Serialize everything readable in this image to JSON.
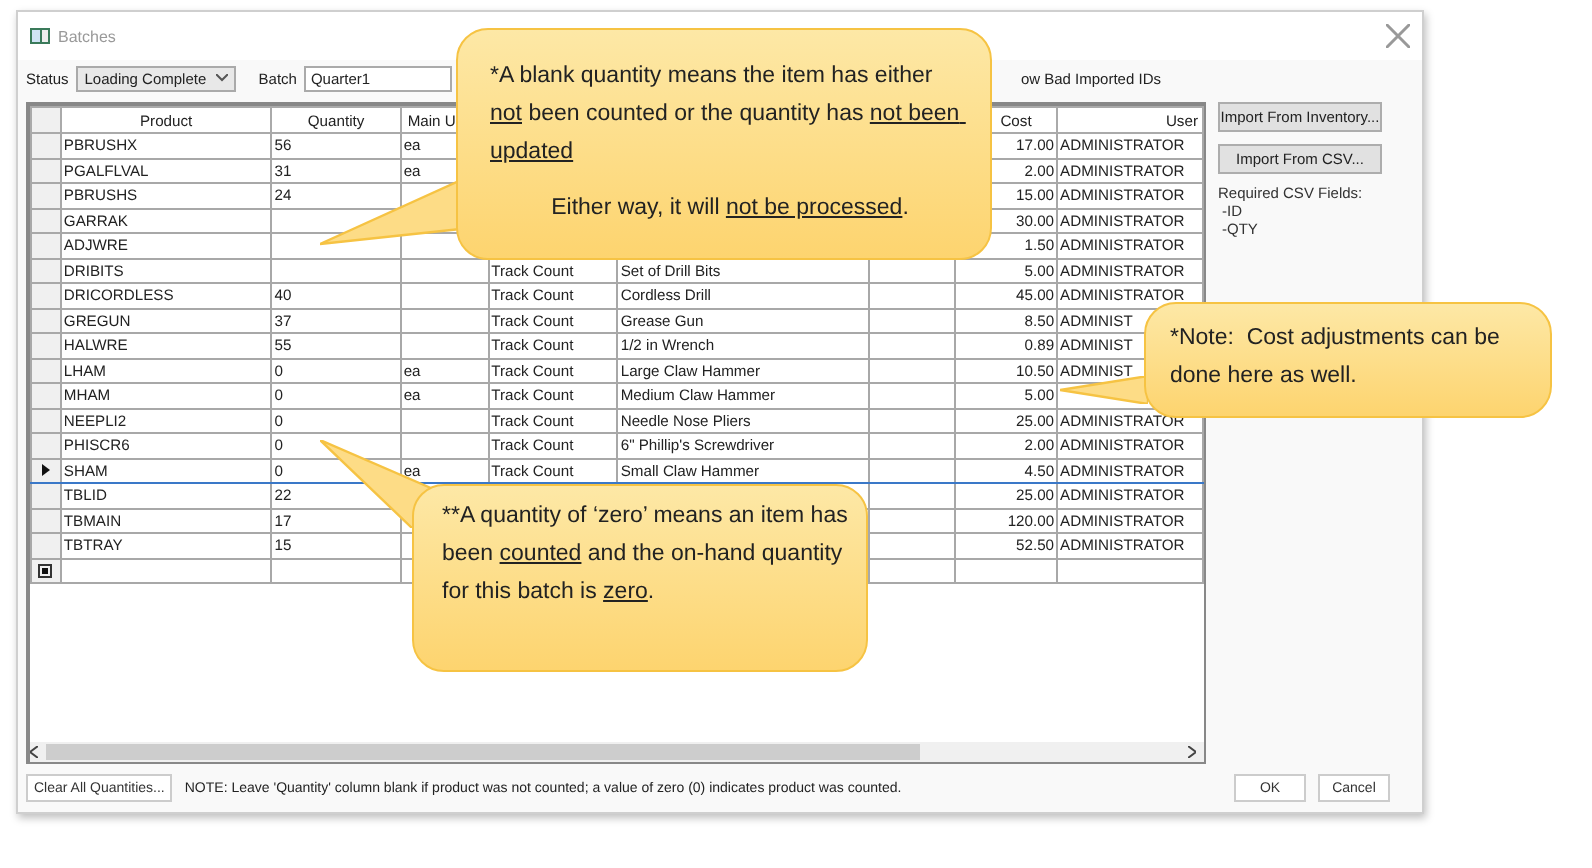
{
  "window": {
    "title": "Batches"
  },
  "toolbar": {
    "status_label": "Status",
    "status_value": "Loading Complete",
    "batch_label": "Batch",
    "batch_value": "Quarter1",
    "show_bad_ids_label": "ow Bad Imported IDs"
  },
  "table": {
    "columns": [
      "Product",
      "Quantity",
      "Main U",
      null,
      null,
      null,
      "Cost",
      "User"
    ],
    "rows": [
      {
        "cells": [
          "PBRUSHX",
          "56",
          "ea",
          null,
          null,
          null,
          "17.00",
          "ADMINISTRATOR"
        ],
        "selected": false
      },
      {
        "cells": [
          "PGALFLVAL",
          "31",
          "ea",
          null,
          null,
          null,
          "2.00",
          "ADMINISTRATOR"
        ],
        "selected": false
      },
      {
        "cells": [
          "PBRUSHS",
          "24",
          null,
          null,
          null,
          null,
          "15.00",
          "ADMINISTRATOR"
        ],
        "selected": false
      },
      {
        "cells": [
          "GARRAK",
          null,
          null,
          null,
          null,
          null,
          "30.00",
          "ADMINISTRATOR"
        ],
        "selected": false
      },
      {
        "cells": [
          "ADJWRE",
          null,
          null,
          null,
          null,
          null,
          "1.50",
          "ADMINISTRATOR"
        ],
        "selected": false
      },
      {
        "cells": [
          "DRIBITS",
          null,
          null,
          "Track Count",
          "Set of Drill Bits",
          null,
          "5.00",
          "ADMINISTRATOR"
        ],
        "selected": false
      },
      {
        "cells": [
          "DRICORDLESS",
          "40",
          null,
          "Track Count",
          "Cordless Drill",
          null,
          "45.00",
          "ADMINISTRATOR"
        ],
        "selected": false
      },
      {
        "cells": [
          "GREGUN",
          "37",
          null,
          "Track Count",
          "Grease Gun",
          null,
          "8.50",
          "ADMINIST"
        ],
        "selected": false
      },
      {
        "cells": [
          "HALWRE",
          "55",
          null,
          "Track Count",
          "1/2 in Wrench",
          null,
          "0.89",
          "ADMINIST"
        ],
        "selected": false
      },
      {
        "cells": [
          "LHAM",
          "0",
          "ea",
          "Track Count",
          "Large Claw Hammer",
          null,
          "10.50",
          "ADMINIST"
        ],
        "selected": false
      },
      {
        "cells": [
          "MHAM",
          "0",
          "ea",
          "Track Count",
          "Medium Claw Hammer",
          null,
          "5.00",
          null
        ],
        "selected": false
      },
      {
        "cells": [
          "NEEPLI2",
          "0",
          null,
          "Track Count",
          "Needle Nose Pliers",
          null,
          "25.00",
          "ADMINISTRATOR"
        ],
        "selected": false
      },
      {
        "cells": [
          "PHISCR6",
          "0",
          null,
          "Track Count",
          "6\" Phillip's Screwdriver",
          null,
          "2.00",
          "ADMINISTRATOR"
        ],
        "selected": false
      },
      {
        "cells": [
          "SHAM",
          "0",
          "ea",
          "Track Count",
          "Small Claw Hammer",
          null,
          "4.50",
          "ADMINISTRATOR"
        ],
        "selected": true
      },
      {
        "cells": [
          "TBLID",
          "22",
          null,
          null,
          null,
          null,
          "25.00",
          "ADMINISTRATOR"
        ],
        "selected": false
      },
      {
        "cells": [
          "TBMAIN",
          "17",
          null,
          null,
          null,
          null,
          "120.00",
          "ADMINISTRATOR"
        ],
        "selected": false
      },
      {
        "cells": [
          "TBTRAY",
          "15",
          null,
          null,
          null,
          null,
          "52.50",
          "ADMINISTRATOR"
        ],
        "selected": false
      }
    ],
    "new_row_marker": true
  },
  "side_panel": {
    "buttons": [
      "Import From Inventory...",
      "Import From CSV..."
    ],
    "csv_title": "Required CSV Fields:",
    "csv_fields": [
      "-ID",
      "-QTY"
    ]
  },
  "footer": {
    "clear_button": "Clear All Quantities...",
    "note": "NOTE: Leave 'Quantity' column blank if product was not counted; a value of zero (0) indicates product was counted.",
    "buttons": [
      "OK",
      "Cancel"
    ]
  },
  "callouts": [
    {
      "kind": "blank",
      "paragraphs": [
        [
          {
            "text": "*A blank quantity means the item has either ",
            "underline": false
          },
          {
            "text": "not",
            "underline": true
          },
          {
            "text": " been counted or the quantity has ",
            "underline": false
          },
          {
            "text": "not been updated",
            "underline": true
          }
        ],
        [
          {
            "text": "Either way, it will ",
            "underline": false
          },
          {
            "text": "not be processed",
            "underline": true
          },
          {
            "text": ".",
            "underline": false
          }
        ]
      ]
    },
    {
      "kind": "cost",
      "paragraphs": [
        [
          {
            "text": "*Note:  Cost adjustments can be done here as well.",
            "underline": false
          }
        ]
      ]
    },
    {
      "kind": "zero",
      "paragraphs": [
        [
          {
            "text": "**A quantity of ‘zero’ means an item has been ",
            "underline": false
          },
          {
            "text": "counted",
            "underline": true
          },
          {
            "text": " and the on-hand quantity for this batch is ",
            "underline": false
          },
          {
            "text": "zero",
            "underline": true
          },
          {
            "text": ".",
            "underline": false
          }
        ]
      ]
    }
  ]
}
